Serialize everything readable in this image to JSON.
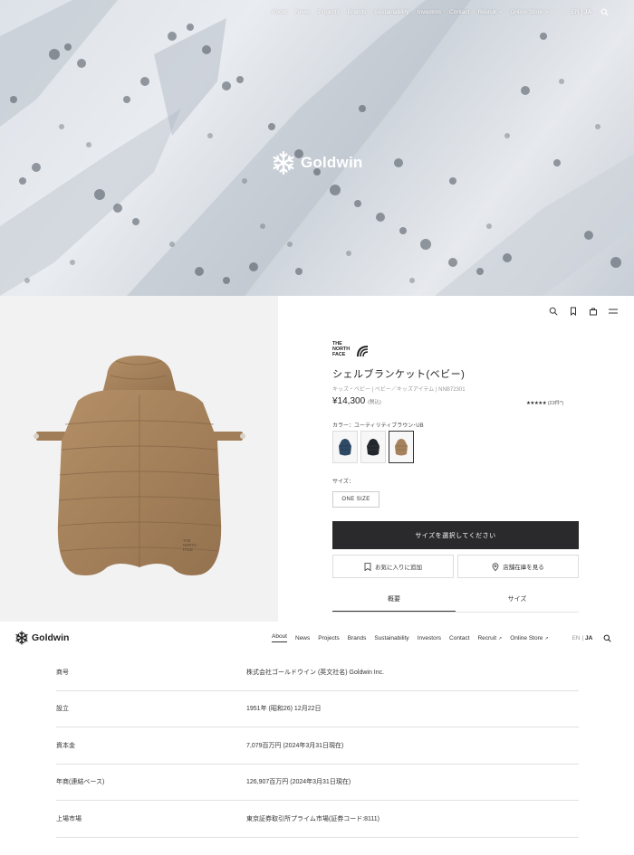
{
  "hero": {
    "nav": [
      {
        "label": "About",
        "external": false
      },
      {
        "label": "News",
        "external": false
      },
      {
        "label": "Projects",
        "external": false
      },
      {
        "label": "Brands",
        "external": false
      },
      {
        "label": "Sustainability",
        "external": false
      },
      {
        "label": "Investors",
        "external": false
      },
      {
        "label": "Contact",
        "external": false
      },
      {
        "label": "Recruit",
        "external": true
      },
      {
        "label": "Online Store",
        "external": true
      }
    ],
    "lang_en": "EN",
    "lang_sep": "|",
    "lang_ja": "JA",
    "logo_text": "Goldwin"
  },
  "product": {
    "brand_logo_lines": [
      "THE",
      "NORTH",
      "FACE"
    ],
    "name": "シェルブランケット(ベビー)",
    "category": "キッズ・ベビー | ベビー／キッズアイテム | NNB72301",
    "price": "¥14,300",
    "tax_note": "(税込)",
    "stars": "★★★★★",
    "review_count": "(23件*)",
    "color_label": "カラー：ユーティリティブラウン･UB",
    "swatches": [
      {
        "name": "navy-blue",
        "color": "#2f4a66",
        "selected": false
      },
      {
        "name": "black",
        "color": "#23262d",
        "selected": false
      },
      {
        "name": "utility-brown",
        "color": "#a6825c",
        "selected": true
      }
    ],
    "size_label": "サイズ：",
    "size_option": "ONE SIZE",
    "cta_label": "サイズを選択してください",
    "favorite_label": "お気に入りに追加",
    "store_label": "店舗在庫を見る",
    "tabs": [
      "概要",
      "サイズ"
    ],
    "jacket_color": "#a6825c",
    "tnf_logo_text": "THE NORTH FACE"
  },
  "goldwin": {
    "logo_text": "Goldwin",
    "nav": [
      {
        "label": "About",
        "external": false
      },
      {
        "label": "News",
        "external": false
      },
      {
        "label": "Projects",
        "external": false
      },
      {
        "label": "Brands",
        "external": false
      },
      {
        "label": "Sustainability",
        "external": false
      },
      {
        "label": "Investors",
        "external": false
      },
      {
        "label": "Contact",
        "external": false
      },
      {
        "label": "Recruit",
        "external": true
      },
      {
        "label": "Online Store",
        "external": true
      }
    ],
    "active_nav": "About",
    "lang_en": "EN",
    "lang_sep": "|",
    "lang_ja": "JA",
    "company_info": [
      {
        "label": "商号",
        "value": "株式会社ゴールドウイン (英文社名) Goldwin Inc."
      },
      {
        "label": "設立",
        "value": "1951年 (昭和26) 12月22日"
      },
      {
        "label": "資本金",
        "value": "7,079百万円 (2024年3月31日現在)"
      },
      {
        "label": "年商(連結ベース)",
        "value": "126,907百万円 (2024年3月31日現在)"
      },
      {
        "label": "上場市場",
        "value": "東京証券取引所プライム市場(証券コード:8111)"
      }
    ]
  }
}
